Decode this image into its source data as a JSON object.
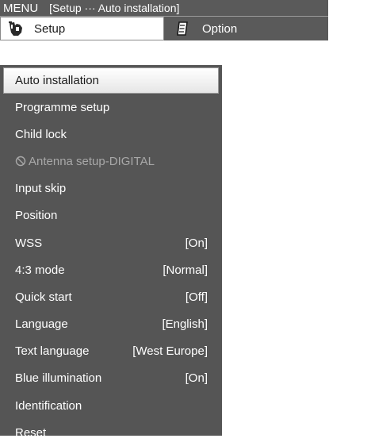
{
  "title_bar": {
    "menu_label": "MENU",
    "breadcrumb": "[Setup ··· Auto installation]"
  },
  "tabs": [
    {
      "label": "Setup",
      "icon": "wrench-hand-icon",
      "active": true
    },
    {
      "label": "Option",
      "icon": "notepad-icon",
      "active": false
    }
  ],
  "menu": {
    "items": [
      {
        "label": "Auto installation",
        "value": "",
        "selected": true,
        "disabled": false
      },
      {
        "label": "Programme setup",
        "value": "",
        "selected": false,
        "disabled": false
      },
      {
        "label": "Child lock",
        "value": "",
        "selected": false,
        "disabled": false
      },
      {
        "label": "Antenna setup-DIGITAL",
        "value": "",
        "selected": false,
        "disabled": true,
        "icon": "prohibited-icon"
      },
      {
        "label": "Input skip",
        "value": "",
        "selected": false,
        "disabled": false
      },
      {
        "label": "Position",
        "value": "",
        "selected": false,
        "disabled": false
      },
      {
        "label": "WSS",
        "value": "[On]",
        "selected": false,
        "disabled": false
      },
      {
        "label": "4:3 mode",
        "value": "[Normal]",
        "selected": false,
        "disabled": false
      },
      {
        "label": "Quick start",
        "value": "[Off]",
        "selected": false,
        "disabled": false
      },
      {
        "label": "Language",
        "value": "[English]",
        "selected": false,
        "disabled": false
      },
      {
        "label": "Text language",
        "value": "[West Europe]",
        "selected": false,
        "disabled": false
      },
      {
        "label": "Blue illumination",
        "value": "[On]",
        "selected": false,
        "disabled": false
      },
      {
        "label": "Identification",
        "value": "",
        "selected": false,
        "disabled": false
      },
      {
        "label": "Reset",
        "value": "",
        "selected": false,
        "disabled": false
      }
    ]
  },
  "colors": {
    "menu_bg": "#555555",
    "title_bg": "#5a5a5a",
    "selected_bg": "#f2f2f2",
    "disabled_text": "#a8a8a8"
  }
}
